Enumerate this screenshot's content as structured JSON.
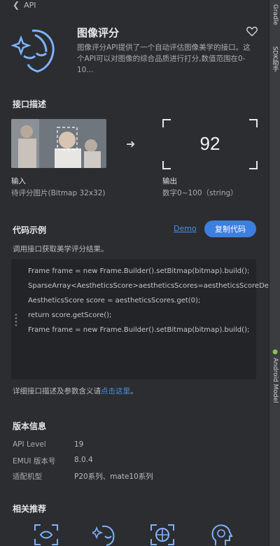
{
  "topbar": {
    "back_label": "API"
  },
  "hero": {
    "title": "图像评分",
    "description": "图像评分API提供了一个自动评估图像美学的接口。这个API可以对图像的综合品质进行打分,数值范围在0-10..."
  },
  "description_section": {
    "title": "接口描述",
    "score": "92",
    "input_label": "输入",
    "input_sub": "待评分图片(Bitmap 32x32)",
    "output_label": "输出",
    "output_sub": "数字0~100（string）"
  },
  "code_section": {
    "title": "代码示例",
    "demo_label": "Demo",
    "copy_label": "复制代码",
    "intro": "调用接口获取美学评分结果。",
    "lines": [
      "Frame frame = new Frame.Builder().setBitmap(bitmap).build();",
      "SparseArray<AestheticsScore>aestheticsScores=aestheticsScoreDetector.detect(frame);",
      "AestheticsScore score = aestheticsScores.get(0);",
      "return score.getScore();",
      "Frame frame = new Frame.Builder().setBitmap(bitmap).build();"
    ],
    "detail_prefix": "详细接口描述及参数含义请",
    "detail_link": "点击这里",
    "detail_suffix": "。"
  },
  "version_section": {
    "title": "版本信息",
    "rows": [
      {
        "key": "API Level",
        "value": "19"
      },
      {
        "key": "EMUI 版本号",
        "value": "8.0.4"
      },
      {
        "key": "适配机型",
        "value": "P20系列、mate10系列"
      }
    ]
  },
  "related_section": {
    "title": "相关推荐",
    "icons": [
      "face-scan-icon",
      "face-sparkle-icon",
      "globe-scan-icon",
      "head-brain-icon"
    ]
  },
  "side_strip": {
    "tabs": [
      "Gradle",
      "SDK助手",
      "Android Model"
    ]
  },
  "colors": {
    "accent": "#3d7fe0",
    "link": "#4a90e2",
    "background": "#2b2d30"
  }
}
